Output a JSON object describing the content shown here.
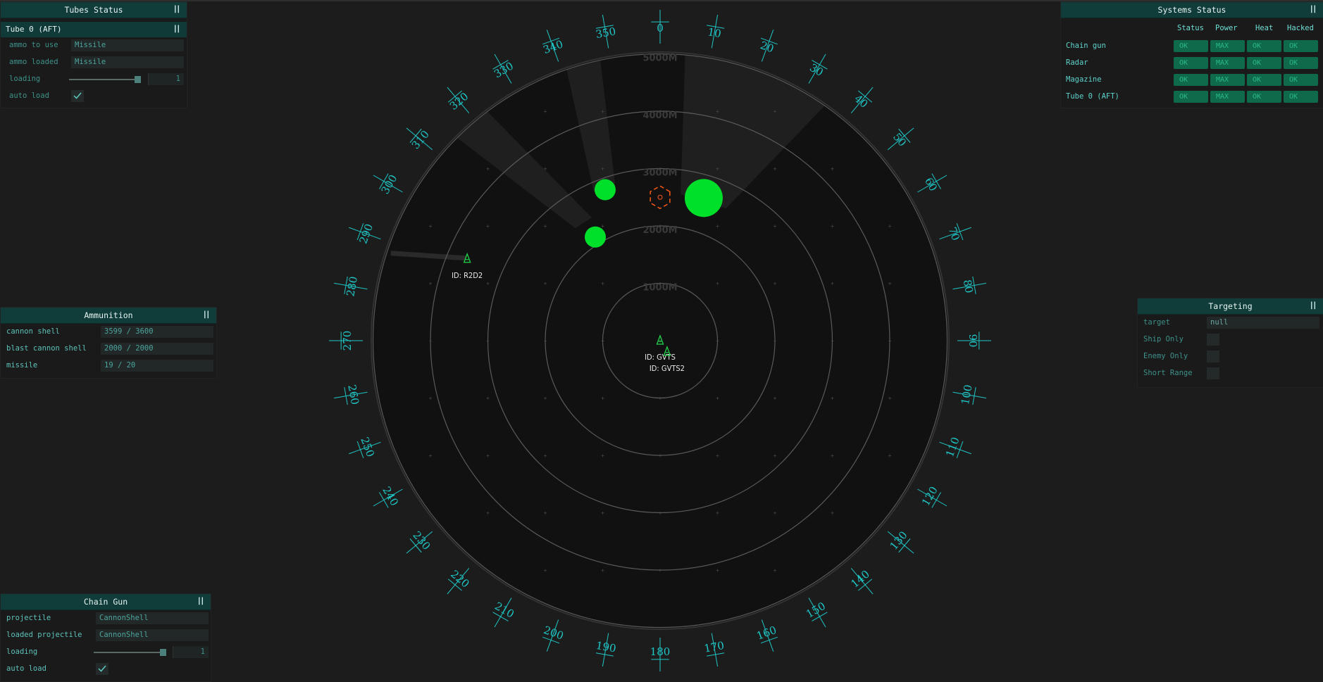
{
  "tubes_status": {
    "title": "Tubes Status",
    "tube": {
      "name": "Tube 0 (AFT)",
      "ammo_to_use_label": "ammo to use",
      "ammo_to_use": "Missile",
      "ammo_loaded_label": "ammo loaded",
      "ammo_loaded": "Missile",
      "loading_label": "loading",
      "loading_value": "1",
      "loading_fraction": 1.0,
      "auto_load_label": "auto load",
      "auto_load": true
    }
  },
  "ammunition": {
    "title": "Ammunition",
    "rows": [
      {
        "label": "cannon shell",
        "value": "3599 / 3600"
      },
      {
        "label": "blast cannon shell",
        "value": "2000 / 2000"
      },
      {
        "label": "missile",
        "value": "19 / 20"
      }
    ]
  },
  "chain_gun": {
    "title": "Chain Gun",
    "projectile_label": "projectile",
    "projectile": "CannonShell",
    "loaded_projectile_label": "loaded projectile",
    "loaded_projectile": "CannonShell",
    "loading_label": "loading",
    "loading_value": "1",
    "loading_fraction": 1.0,
    "auto_load_label": "auto load",
    "auto_load": true
  },
  "systems_status": {
    "title": "Systems Status",
    "columns": [
      "Status",
      "Power",
      "Heat",
      "Hacked"
    ],
    "rows": [
      {
        "name": "Chain gun",
        "status": "OK",
        "power": "MAX",
        "heat": "OK",
        "hacked": "OK"
      },
      {
        "name": "Radar",
        "status": "OK",
        "power": "MAX",
        "heat": "OK",
        "hacked": "OK"
      },
      {
        "name": "Magazine",
        "status": "OK",
        "power": "MAX",
        "heat": "OK",
        "hacked": "OK"
      },
      {
        "name": "Tube 0 (AFT)",
        "status": "OK",
        "power": "MAX",
        "heat": "OK",
        "hacked": "OK"
      }
    ]
  },
  "targeting": {
    "title": "Targeting",
    "target_label": "target",
    "target": "null",
    "ship_only_label": "Ship Only",
    "enemy_only_label": "Enemy Only",
    "short_range_label": "Short Range"
  },
  "radar": {
    "range_labels": [
      "1000M",
      "2000M",
      "3000M",
      "4000M",
      "5000M"
    ],
    "bearings": [
      "0",
      "10",
      "20",
      "30",
      "40",
      "50",
      "60",
      "70",
      "80",
      "90",
      "100",
      "110",
      "120",
      "130",
      "140",
      "150",
      "160",
      "170",
      "180",
      "190",
      "200",
      "210",
      "220",
      "230",
      "240",
      "250",
      "260",
      "270",
      "280",
      "290",
      "300",
      "310",
      "320",
      "330",
      "340",
      "350"
    ],
    "ships": [
      {
        "id": "ID: GVTS",
        "bearing_deg": 0,
        "range_m": 0
      },
      {
        "id": "ID: GVTS2",
        "bearing_deg": 148,
        "range_m": 230
      },
      {
        "id": "ID: R2D2",
        "bearing_deg": 293,
        "range_m": 3650
      }
    ],
    "contacts": [
      {
        "bearing_deg": 328,
        "range_m": 2130,
        "size": "medium"
      },
      {
        "bearing_deg": 340,
        "range_m": 2800,
        "size": "medium"
      },
      {
        "bearing_deg": 17,
        "range_m": 2600,
        "size": "large"
      }
    ],
    "colors": {
      "bearing": "#1fc7c7",
      "contact": "#00e02a",
      "ship": "#22d24a",
      "target_marker": "#ff5a14"
    }
  }
}
